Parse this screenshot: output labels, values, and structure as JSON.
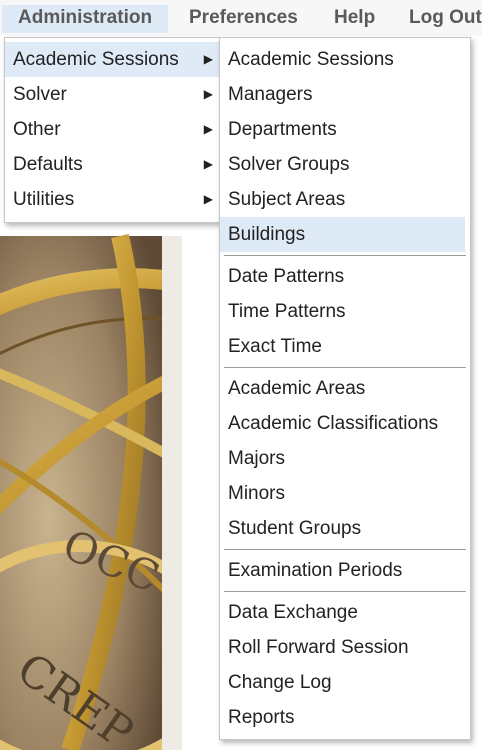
{
  "menubar": {
    "items": [
      {
        "label": "Administration",
        "active": true
      },
      {
        "label": "Preferences",
        "active": false
      },
      {
        "label": "Help",
        "active": false
      },
      {
        "label": "Log Out",
        "active": false
      }
    ]
  },
  "primary_menu": {
    "items": [
      {
        "label": "Academic Sessions",
        "has_submenu": true,
        "highlighted": true
      },
      {
        "label": "Solver",
        "has_submenu": true
      },
      {
        "label": "Other",
        "has_submenu": true
      },
      {
        "label": "Defaults",
        "has_submenu": true
      },
      {
        "label": "Utilities",
        "has_submenu": true
      }
    ]
  },
  "submenu": {
    "groups": [
      [
        "Academic Sessions",
        "Managers",
        "Departments",
        "Solver Groups",
        "Subject Areas",
        "Buildings"
      ],
      [
        "Date Patterns",
        "Time Patterns",
        "Exact Time"
      ],
      [
        "Academic Areas",
        "Academic Classifications",
        "Majors",
        "Minors",
        "Student Groups"
      ],
      [
        "Examination Periods"
      ],
      [
        "Data Exchange",
        "Roll Forward Session",
        "Change Log",
        "Reports"
      ]
    ],
    "highlighted": "Buildings"
  },
  "background_image": {
    "visible_text": [
      "OCC",
      "CREP"
    ]
  },
  "icons": {
    "submenu_arrow": "triangle-right-icon"
  },
  "colors": {
    "highlight": "#dfeaf7",
    "menubar_text": "#5a5a5a",
    "menu_text": "#222222"
  }
}
